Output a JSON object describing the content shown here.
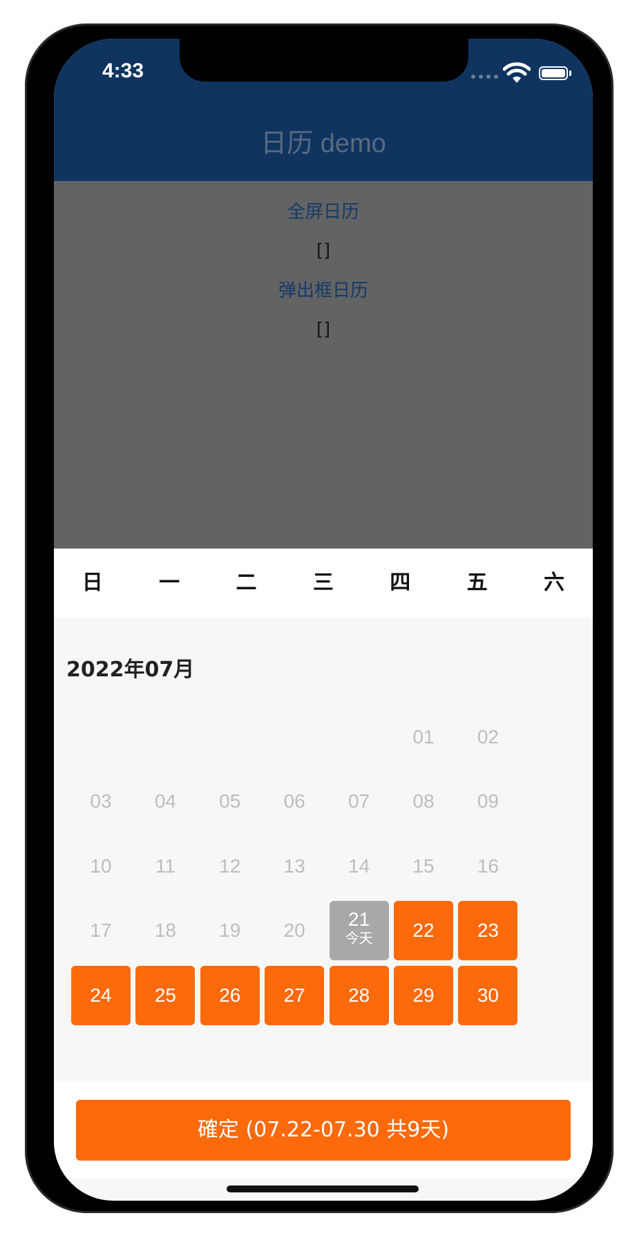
{
  "status_bar": {
    "time": "4:33"
  },
  "app_bar": {
    "title": "日历 demo"
  },
  "page": {
    "fullscreen_link": "全屏日历",
    "fullscreen_value": "[]",
    "popup_link": "弹出框日历",
    "popup_value": "[]"
  },
  "calendar": {
    "weekdays": [
      "日",
      "一",
      "二",
      "三",
      "四",
      "五",
      "六"
    ],
    "month_title": "2022年07月",
    "days": [
      {
        "label": "01",
        "state": "past"
      },
      {
        "label": "02",
        "state": "past"
      },
      {
        "label": "03",
        "state": "past"
      },
      {
        "label": "04",
        "state": "past"
      },
      {
        "label": "05",
        "state": "past"
      },
      {
        "label": "06",
        "state": "past"
      },
      {
        "label": "07",
        "state": "past"
      },
      {
        "label": "08",
        "state": "past"
      },
      {
        "label": "09",
        "state": "past"
      },
      {
        "label": "10",
        "state": "past"
      },
      {
        "label": "11",
        "state": "past"
      },
      {
        "label": "12",
        "state": "past"
      },
      {
        "label": "13",
        "state": "past"
      },
      {
        "label": "14",
        "state": "past"
      },
      {
        "label": "15",
        "state": "past"
      },
      {
        "label": "16",
        "state": "past"
      },
      {
        "label": "17",
        "state": "past"
      },
      {
        "label": "18",
        "state": "past"
      },
      {
        "label": "19",
        "state": "past"
      },
      {
        "label": "20",
        "state": "past"
      },
      {
        "label": "21",
        "state": "today",
        "sub": "今天"
      },
      {
        "label": "22",
        "state": "selected"
      },
      {
        "label": "23",
        "state": "selected"
      },
      {
        "label": "24",
        "state": "selected"
      },
      {
        "label": "25",
        "state": "selected"
      },
      {
        "label": "26",
        "state": "selected"
      },
      {
        "label": "27",
        "state": "selected"
      },
      {
        "label": "28",
        "state": "selected"
      },
      {
        "label": "29",
        "state": "selected"
      },
      {
        "label": "30",
        "state": "selected"
      }
    ],
    "first_weekday_index": 5
  },
  "footer": {
    "confirm_label": "確定 (07.22-07.30 共9天)"
  },
  "colors": {
    "app_bar": "#0f3460",
    "accent": "#fc6a0c",
    "today": "#a8a8a8",
    "overlay": "#636363"
  }
}
